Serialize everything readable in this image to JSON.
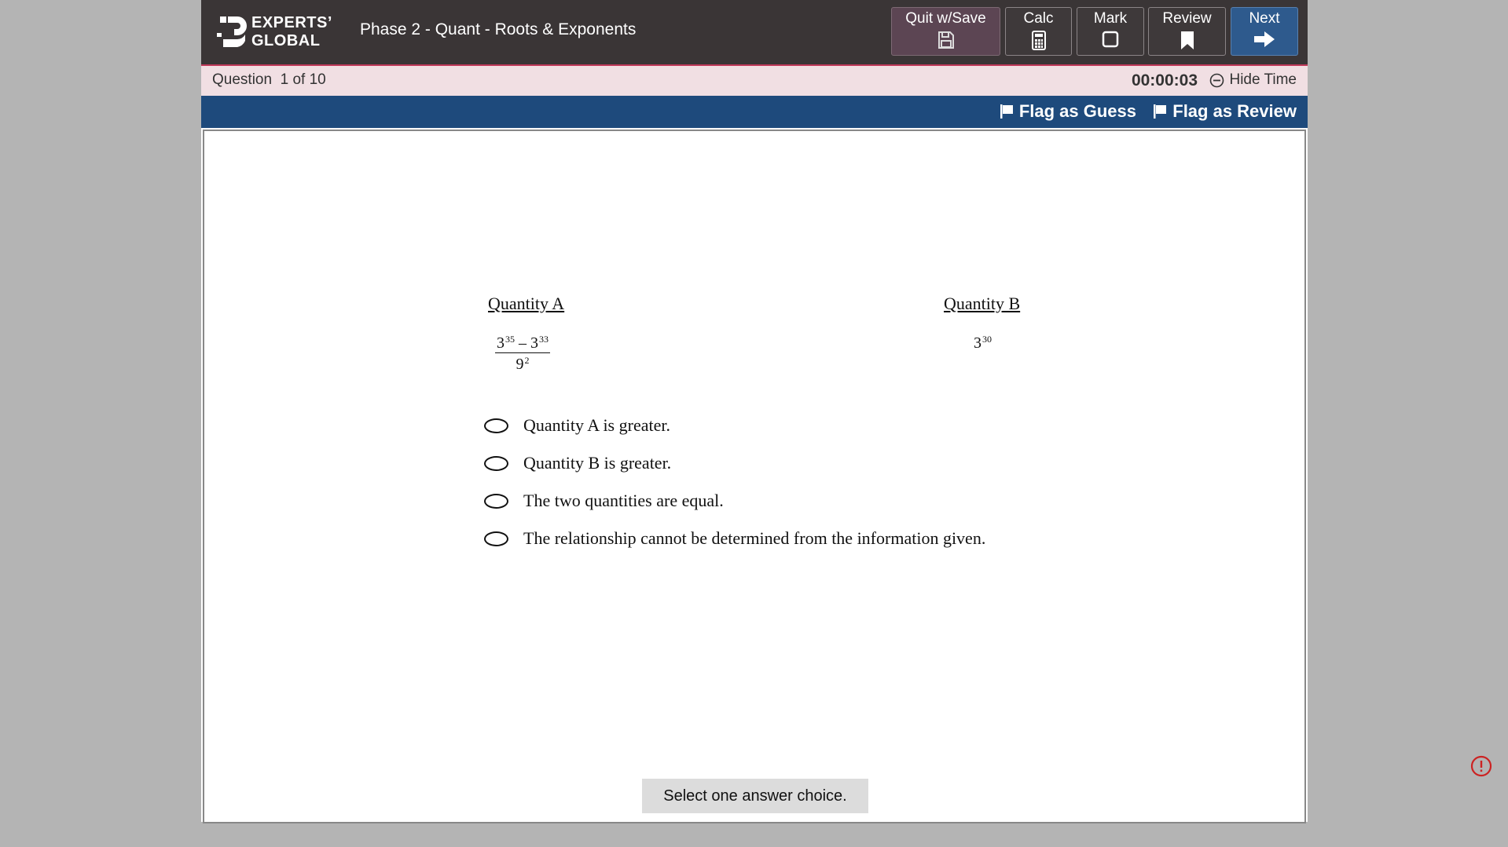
{
  "header": {
    "logo_line1": "EXPERTS’",
    "logo_line2": "GLOBAL",
    "test_title": "Phase 2 - Quant - Roots & Exponents",
    "buttons": {
      "quit": "Quit w/Save",
      "calc": "Calc",
      "mark": "Mark",
      "review": "Review",
      "next": "Next"
    }
  },
  "question_bar": {
    "counter": "Question  1 of 10",
    "timer": "00:00:03",
    "hide_time": "Hide Time"
  },
  "flag_bar": {
    "flag_guess": "Flag as Guess",
    "flag_review": "Flag as Review"
  },
  "question": {
    "quantity_a_header": "Quantity A",
    "quantity_b_header": "Quantity B",
    "quantity_a": {
      "num_base1": "3",
      "num_exp1": "35",
      "minus": " – ",
      "num_base2": "3",
      "num_exp2": "33",
      "den_base": "9",
      "den_exp": "2"
    },
    "quantity_b": {
      "base": "3",
      "exp": "30"
    },
    "choices": [
      "Quantity A is greater.",
      "Quantity B is greater.",
      "The two quantities are equal.",
      "The relationship cannot be determined from the information given."
    ]
  },
  "status_message": "Select one answer choice.",
  "colors": {
    "background": "#b4b4b4",
    "topbar": "#3a3536",
    "question_bar": "#f1dfe3",
    "flag_bar": "#1e4a7c",
    "next_button": "#2e5a8d",
    "quit_button": "#5c4553",
    "alert": "#cc2222"
  },
  "icons": {
    "quit": "floppy-disk-icon",
    "calc": "calculator-icon",
    "mark": "checkbox-icon",
    "review": "bookmark-icon",
    "next": "arrow-right-icon",
    "hide_time": "minus-circle-icon",
    "flag": "flag-icon",
    "alert": "alert-circle-icon"
  }
}
